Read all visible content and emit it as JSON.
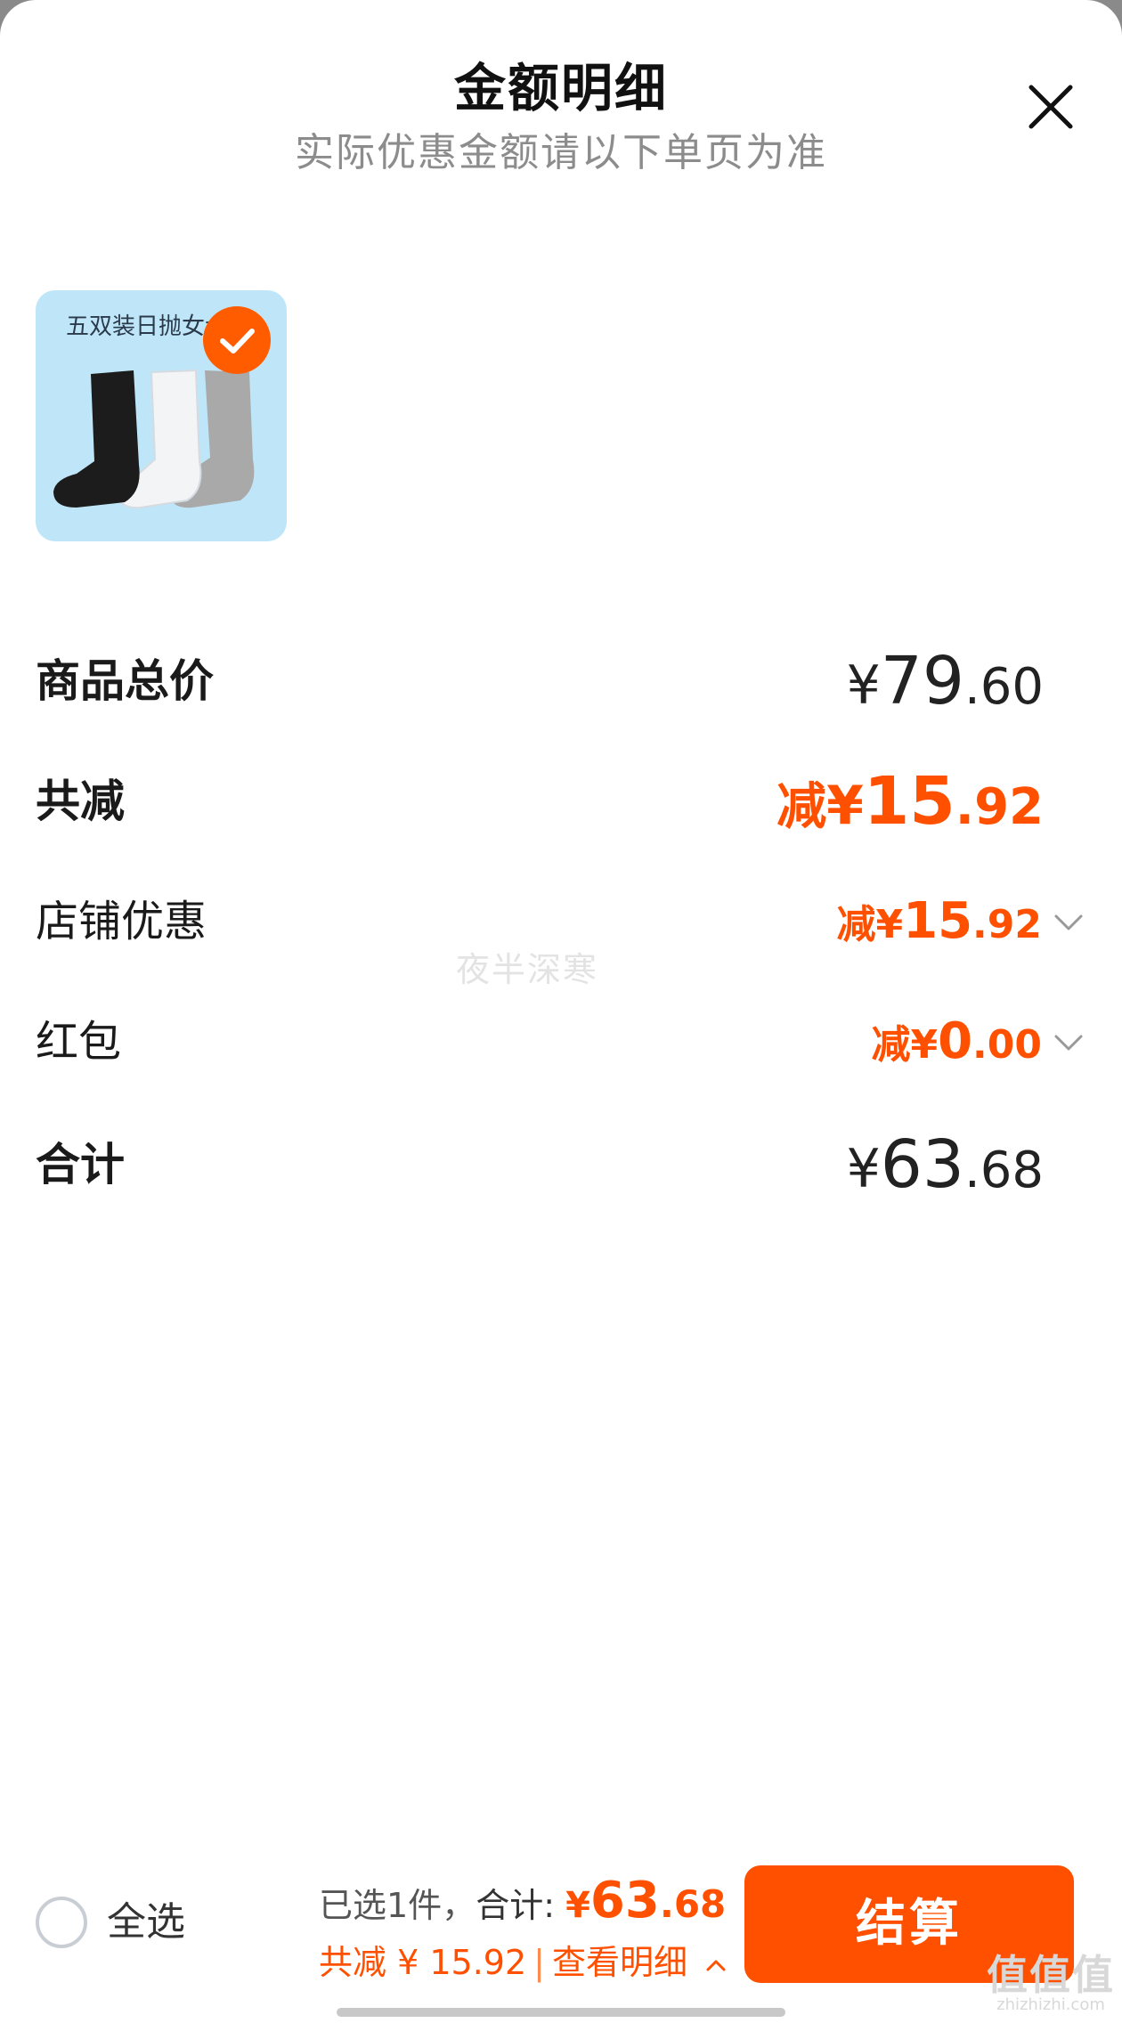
{
  "header": {
    "title": "金额明细",
    "subtitle": "实际优惠金额请以下单页为准"
  },
  "product": {
    "thumbnail_text": "五双装日抛女士"
  },
  "rows": [
    {
      "label": "商品总价",
      "prefix": "",
      "symbol": "¥",
      "int": "79",
      "dec": ".60"
    },
    {
      "label": "共减",
      "prefix": "减",
      "symbol": "¥",
      "int": "15",
      "dec": ".92"
    },
    {
      "label": "店铺优惠",
      "prefix": "减",
      "symbol": "¥",
      "int": "15",
      "dec": ".92"
    },
    {
      "label": "红包",
      "prefix": "减",
      "symbol": "¥",
      "int": "0",
      "dec": ".00"
    },
    {
      "label": "合计",
      "prefix": "",
      "symbol": "¥",
      "int": "63",
      "dec": ".68"
    }
  ],
  "watermark": "夜半深寒",
  "footer": {
    "select_all": "全选",
    "selected": "已选1件，",
    "total_label": "合计: ",
    "total_symbol": "¥",
    "total_int": "63",
    "total_dec": ".68",
    "discount": "共减 ¥ 15.92",
    "separator": "|",
    "detail_link": "查看明细",
    "checkout": "结算"
  },
  "site_mark": {
    "logo": "值值值",
    "url": "zhizhizhi.com"
  },
  "colors": {
    "accent": "#ff5000",
    "text": "#1a1a1a",
    "muted": "#8c8c8c"
  },
  "icons": [
    "close-icon",
    "checkmark-icon",
    "chevron-down-icon",
    "chevron-up-icon",
    "radio-icon"
  ]
}
